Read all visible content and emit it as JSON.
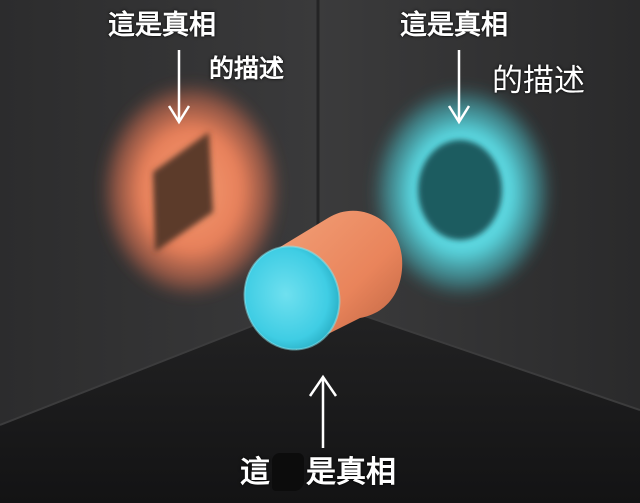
{
  "captions": {
    "left_top": "這是真相",
    "left_sub": "的描述",
    "right_top": "這是真相",
    "right_sub": "的描述",
    "bottom_before": "這",
    "bottom_after": "是真相"
  },
  "colors": {
    "background": "#2f2f30",
    "floor": "#1b1b1c",
    "orange_glow": "#e8805a",
    "orange_shape": "#5b3a2c",
    "cyan_glow": "#58d6df",
    "cyan_shape": "#1d5b60",
    "cylinder_side": "#ee8a5f",
    "cylinder_face": "#3fd0e6"
  },
  "icons": [
    "down-arrow-icon",
    "down-arrow-icon",
    "up-arrow-icon"
  ]
}
